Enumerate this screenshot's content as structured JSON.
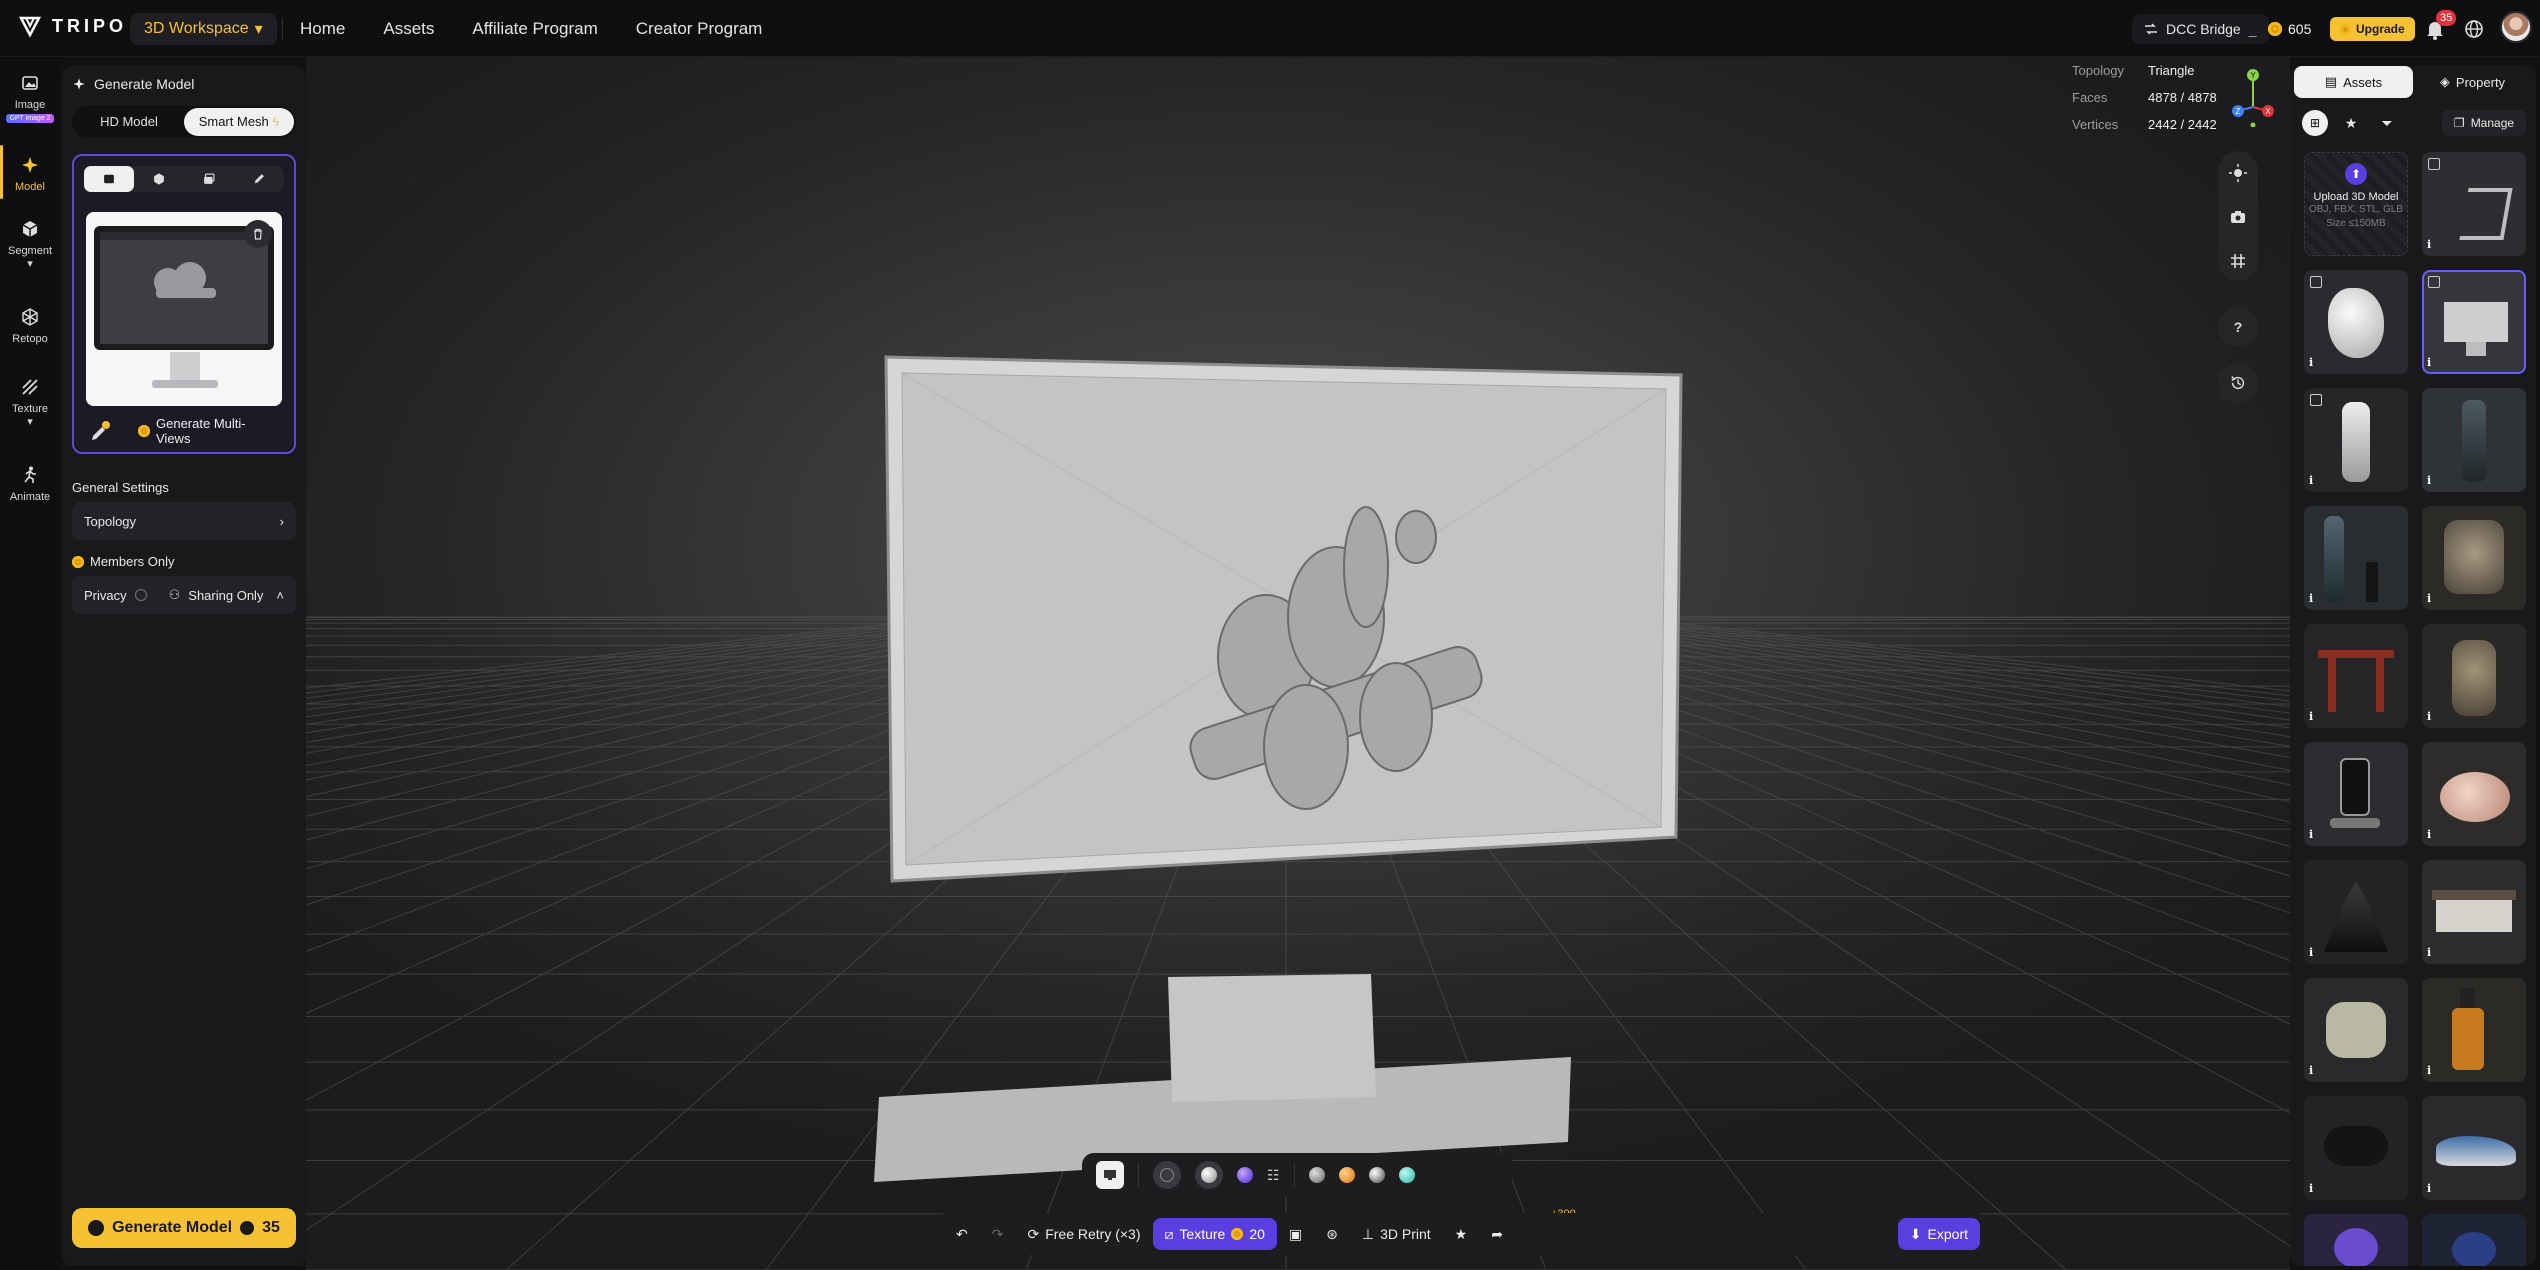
{
  "app": {
    "logo_text": "TRIPO",
    "workspace_label": "3D Workspace"
  },
  "nav": [
    "Home",
    "Assets",
    "Affiliate Program",
    "Creator Program"
  ],
  "header_right": {
    "dcc_label": "DCC Bridge",
    "credits": "605",
    "upgrade_label": "Upgrade",
    "notifications": "35"
  },
  "left_rail": [
    {
      "label": "Image",
      "badge": "GPT image 2",
      "icon": "image-icon"
    },
    {
      "label": "Model",
      "icon": "sparkle-icon"
    },
    {
      "label": "Segment",
      "icon": "cube-split-icon"
    },
    {
      "label": "Retopo",
      "icon": "mesh-icon"
    },
    {
      "label": "Texture",
      "icon": "brush-icon"
    },
    {
      "label": "Animate",
      "icon": "running-figure-icon"
    }
  ],
  "left_panel": {
    "title": "Generate Model",
    "modes": [
      "HD Model",
      "Smart Mesh"
    ],
    "multiview_label": "Generate Multi-Views",
    "general_settings": "General Settings",
    "topology_label": "Topology",
    "members_only": "Members Only",
    "privacy_label": "Privacy",
    "privacy_value": "Sharing Only",
    "generate_label": "Generate Model",
    "generate_cost": "35"
  },
  "stats": [
    {
      "key": "Topology",
      "value": "Triangle"
    },
    {
      "key": "Faces",
      "value": "4878 / 4878"
    },
    {
      "key": "Vertices",
      "value": "2442 / 2442"
    }
  ],
  "gizmo": {
    "y": "Y",
    "z": "Z",
    "x": "X"
  },
  "action_bar": {
    "free_retry": "Free Retry (×3)",
    "texture": "Texture",
    "texture_cost": "20",
    "print": "3D Print",
    "share_bonus": "+300",
    "export": "Export"
  },
  "right_panel": {
    "tabs": [
      "Assets",
      "Property"
    ],
    "manage": "Manage",
    "upload_title": "Upload 3D Model",
    "upload_formats": "OBJ, FBX, STL, GLB",
    "upload_size": "Size ≤150MB"
  },
  "colors": {
    "accent": "#f4c233",
    "purple": "#5b3ee0",
    "bg": "#111113"
  }
}
